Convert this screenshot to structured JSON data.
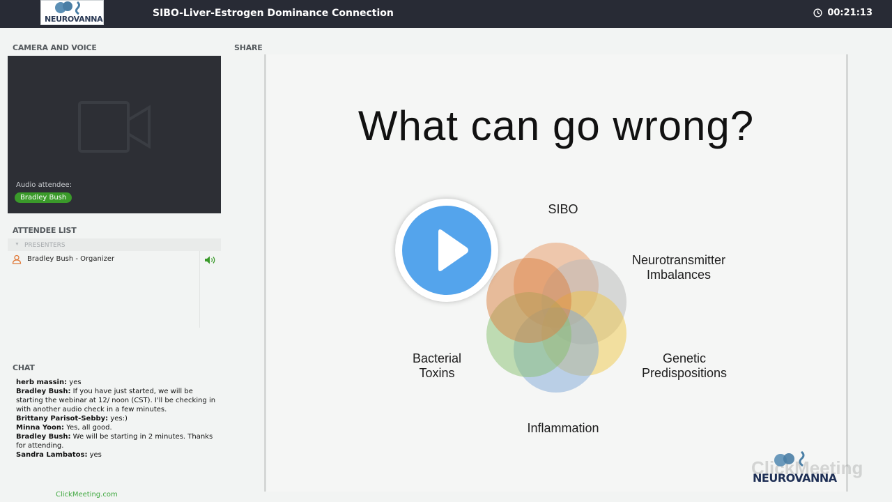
{
  "header": {
    "logo_text": "NEUROVANNA",
    "title": "SIBO-Liver-Estrogen Dominance Connection",
    "timer": "00:21:13"
  },
  "camera": {
    "label": "CAMERA AND VOICE",
    "audio_label": "Audio attendee:",
    "audio_attendee": "Bradley Bush"
  },
  "attendees": {
    "label": "ATTENDEE LIST",
    "group": "PRESENTERS",
    "items": [
      {
        "name": "Bradley Bush  - Organizer"
      }
    ]
  },
  "chat": {
    "label": "CHAT",
    "messages": [
      {
        "author": "herb massin:",
        "text": " yes"
      },
      {
        "author": "Bradley Bush:",
        "text": " If you have just started, we will be starting the webinar at 12/ noon (CST). I'll be checking in with another audio check in a few minutes."
      },
      {
        "author": "Brittany  Parisot-Sebby:",
        "text": " yes:)"
      },
      {
        "author": "Minna Yoon:",
        "text": " Yes, all good."
      },
      {
        "author": "Bradley Bush:",
        "text": " We will be starting in 2 minutes. Thanks for attending."
      },
      {
        "author": "Sandra Lambatos:",
        "text": " yes"
      }
    ]
  },
  "share": {
    "label": "SHARE",
    "slide": {
      "title": "What can go wrong?",
      "labels": {
        "sibo": "SIBO",
        "neuro_line1": "Neurotransmitter",
        "neuro_line2": "Imbalances",
        "genetic_line1": "Genetic",
        "genetic_line2": "Predispositions",
        "inflammation": "Inflammation",
        "bacterial_line1": "Bacterial",
        "bacterial_line2": "Toxins"
      },
      "circle_colors": {
        "sibo": "#e8a070",
        "neuro": "#b8b8b8",
        "genetic": "#f0c84a",
        "inflammation": "#7fa8d8",
        "bacterial": "#88c070",
        "toxins": "#d98040"
      },
      "watermark": "ClickMeeting",
      "logo_text": "NEUROVANNA"
    }
  },
  "footer": {
    "link": "ClickMeeting.com"
  },
  "colors": {
    "topbar": "#282b35",
    "accent_green": "#3a9a2a",
    "play_blue": "#54a4ec"
  }
}
